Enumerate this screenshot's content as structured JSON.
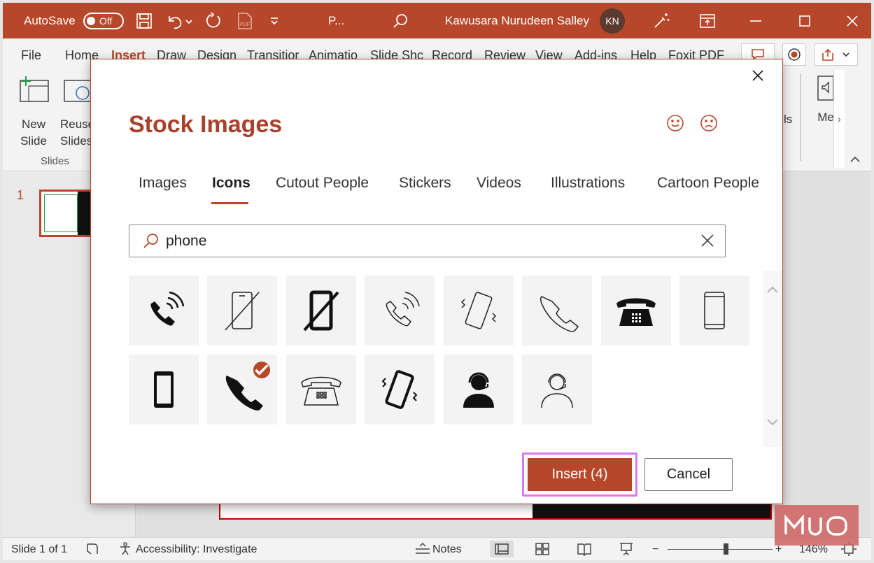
{
  "titlebar": {
    "autosave_label": "AutoSave",
    "autosave_state": "Off",
    "filename": "P...",
    "user_name": "Kawusara Nurudeen Salley",
    "user_initials": "KN"
  },
  "ribbon": {
    "tabs": [
      "File",
      "Home",
      "Insert",
      "Draw",
      "Design",
      "Transitior",
      "Animatio",
      "Slide Shc",
      "Record",
      "Review",
      "View",
      "Add-ins",
      "Help",
      "Foxit PDF"
    ],
    "new_slide": {
      "line1": "New",
      "line2": "Slide"
    },
    "reuse_slides": {
      "line1": "Reuse",
      "line2": "Slides"
    },
    "group_slides": "Slides",
    "right_cut_label_1": "ls",
    "right_cut_label_2": "Me"
  },
  "slide_pane": {
    "slide_number": "1"
  },
  "dialog": {
    "title": "Stock Images",
    "tabs": [
      "Images",
      "Icons",
      "Cutout People",
      "Stickers",
      "Videos",
      "Illustrations",
      "Cartoon People"
    ],
    "active_tab": "Icons",
    "search_value": "phone",
    "icons": [
      {
        "icon": "phone-ringing-filled-icon",
        "selected": false
      },
      {
        "icon": "mobile-off-outline-icon",
        "selected": false
      },
      {
        "icon": "mobile-off-filled-icon",
        "selected": false
      },
      {
        "icon": "phone-ringing-outline-icon",
        "selected": false
      },
      {
        "icon": "mobile-vibrate-outline-icon",
        "selected": false
      },
      {
        "icon": "phone-handset-outline-icon",
        "selected": false
      },
      {
        "icon": "desk-phone-filled-icon",
        "selected": false
      },
      {
        "icon": "mobile-outline-icon",
        "selected": false
      },
      {
        "icon": "mobile-filled-icon",
        "selected": false
      },
      {
        "icon": "phone-handset-filled-icon",
        "selected": true
      },
      {
        "icon": "desk-phone-outline-icon",
        "selected": false
      },
      {
        "icon": "mobile-vibrate-filled-icon",
        "selected": false
      },
      {
        "icon": "headset-person-filled-icon",
        "selected": false
      },
      {
        "icon": "headset-person-outline-icon",
        "selected": false
      }
    ],
    "insert_label": "Insert (4)",
    "cancel_label": "Cancel"
  },
  "statusbar": {
    "slide_info": "Slide 1 of 1",
    "accessibility": "Accessibility: Investigate",
    "notes": "Notes",
    "zoom": "146%"
  },
  "watermark": "MUO",
  "colors": {
    "accent": "#b7472a",
    "highlight": "#d67bea",
    "tile_bg": "#f3f3f3"
  }
}
